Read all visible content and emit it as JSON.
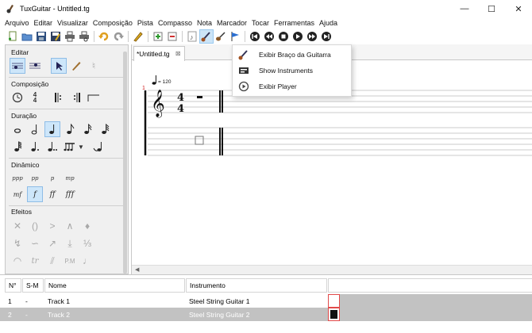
{
  "window": {
    "title": "TuxGuitar - Untitled.tg",
    "minimize": "—",
    "maximize": "☐",
    "close": "✕"
  },
  "menu": [
    "Arquivo",
    "Editar",
    "Visualizar",
    "Composição",
    "Pista",
    "Compasso",
    "Nota",
    "Marcador",
    "Tocar",
    "Ferramentas",
    "Ajuda"
  ],
  "left_panel": {
    "editar": "Editar",
    "composicao": "Composição",
    "duracao": "Duração",
    "dinamico": "Dinâmico",
    "efeitos": "Efeitos",
    "dynamics": [
      "ppp",
      "pp",
      "p",
      "mp",
      "mf",
      "f",
      "ff",
      "fff"
    ],
    "effects_text": [
      "tr",
      "P.M"
    ]
  },
  "editor": {
    "tab_label": "*Untitled.tg",
    "tab_close": "⊠",
    "tempo": "= 120",
    "measure_number": "1",
    "time_sig_top": "4",
    "time_sig_bottom": "4"
  },
  "dropdown": {
    "items": [
      "Exibir Braço da Guitarra",
      "Show Instruments",
      "Exibir Player"
    ]
  },
  "tracks": {
    "headers": [
      "N°",
      "S-M",
      "Nome",
      "Instrumento"
    ],
    "rows": [
      {
        "num": "1",
        "sm": "-",
        "name": "Track 1",
        "instrument": "Steel String Guitar 1"
      },
      {
        "num": "2",
        "sm": "-",
        "name": "Track 2",
        "instrument": "Steel String Guitar 2"
      }
    ]
  },
  "colors": {
    "selection_blue": "#cde6fa",
    "track_selected": "#c2c2c2",
    "timeline_red": "#e24a4a"
  }
}
